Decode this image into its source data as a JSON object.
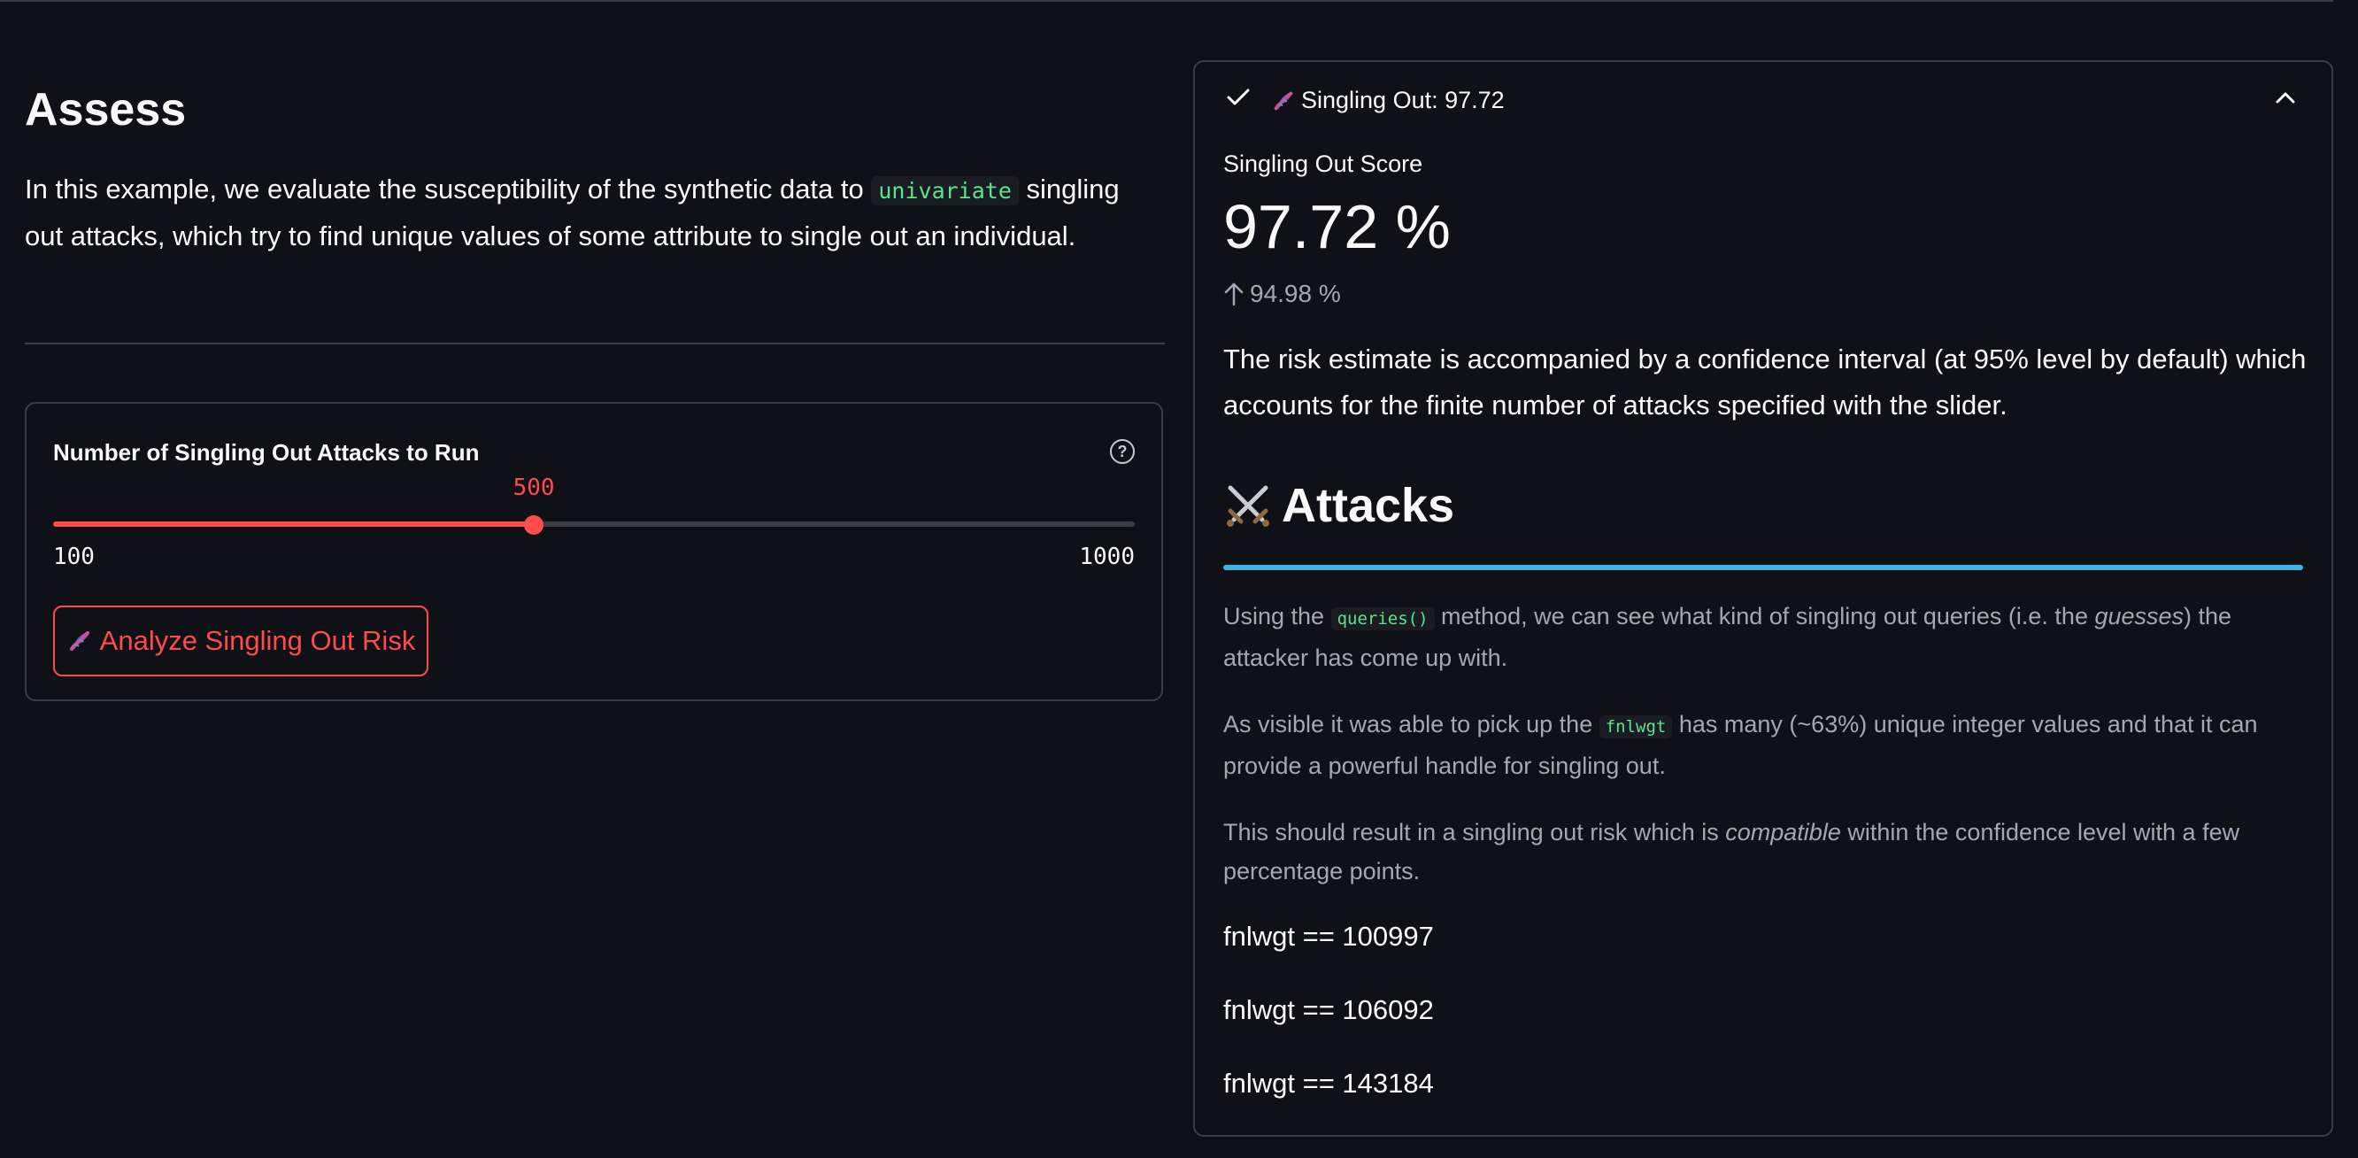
{
  "left": {
    "title": "Assess",
    "intro_before": "In this example, we evaluate the susceptibility of the synthetic data to ",
    "intro_code": "univariate",
    "intro_after": " singling out attacks, which try to find unique values of some attribute to single out an individual.",
    "slider": {
      "label": "Number of Singling Out Attacks to Run",
      "value": "500",
      "min": "100",
      "max": "1000",
      "value_numeric": 500,
      "min_numeric": 100,
      "max_numeric": 1000
    },
    "analyze_button": "Analyze Singling Out Risk"
  },
  "panel": {
    "header": "Singling Out: 97.72",
    "metric_label": "Singling Out Score",
    "metric_value": "97.72 %",
    "metric_delta": "94.98 %",
    "risk_text": "The risk estimate is accompanied by a confidence interval (at 95% level by default) which accounts for the finite number of attacks specified with the slider.",
    "attacks_heading": "Attacks",
    "p1_before": "Using the ",
    "p1_code": "queries()",
    "p1_mid": " method, we can see what kind of singling out queries (i.e. the ",
    "p1_em": "guesses",
    "p1_after": ") the attacker has come up with.",
    "p2_before": "As visible it was able to pick up the ",
    "p2_code": "fnlwgt",
    "p2_after": " has many (~63%) unique integer values and that it can provide a powerful handle for singling out.",
    "p3_before": "This should result in a singling out risk which is ",
    "p3_em": "compatible",
    "p3_after": " within the confidence level with a few percentage points.",
    "queries": [
      "fnlwgt == 100997",
      "fnlwgt == 106092",
      "fnlwgt == 143184"
    ]
  },
  "icons": {
    "dna": "dna-icon",
    "check": "check-icon",
    "chevron": "chevron-up-icon",
    "help": "help-circle-icon",
    "swords": "crossed-swords-icon",
    "arrow": "arrow-up-icon"
  },
  "colors": {
    "background": "#0f1117",
    "accent": "#ff4b4b",
    "heading_rule": "#3fb1e3",
    "code": "#5ce488"
  }
}
